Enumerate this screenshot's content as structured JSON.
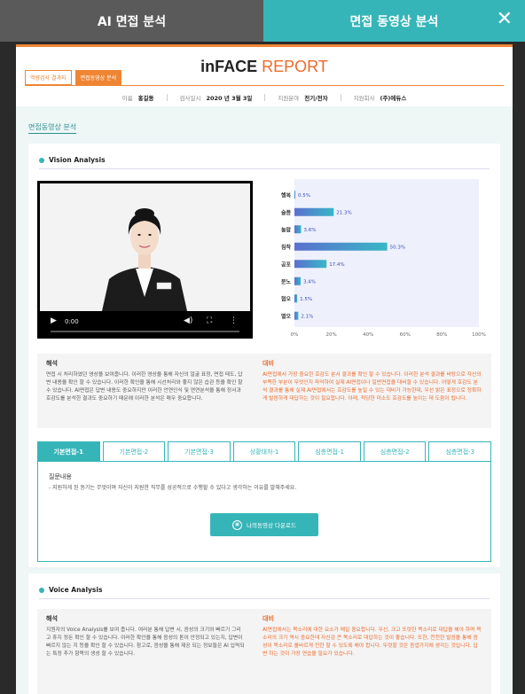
{
  "topbar": {
    "left_tab": "AI 면접 분석",
    "right_tab": "면접 동영상 분석",
    "close_icon": "close-icon"
  },
  "report": {
    "subtabs": [
      "역량검사 결과지",
      "면접동영상 분석"
    ],
    "title_bold": "inFACE",
    "title_rest": "REPORT",
    "info": [
      {
        "label": "이름",
        "value": "홍길동"
      },
      {
        "label": "검사일시",
        "value": "2020 년 3월 3일"
      },
      {
        "label": "지원분야",
        "value": "전기/전자"
      },
      {
        "label": "지원회사",
        "value": "(주)에듀스"
      }
    ]
  },
  "section_label": "면접동영상 분석",
  "vision": {
    "title": "Vision Analysis",
    "video_time": "0:00",
    "analysis_title": "해석",
    "analysis_text": "면접 시 처리하였던 영상을 보여줍니다. 이러한 영상을 통해 자신의 얼굴 표정, 면접 태도, 답변 내용을 확인 할 수 있습니다. 이러한 확인을 통해 시선처리와 좋지 않은 습관 등을 확인 할 수 있습니다. AI면접은 답변 내용도 중요하지만 이러한 언연인식 및 연연분석을 통해 정서과 호감도를 분석한 결과도 중요하기 때문에 이러한 분석은 매우 중요합니다.",
    "advice_title": "대비",
    "advice_text": "AI면접에서 가장 중요한 호감도 분서 결과를 확인 할 수 있습니다. 이러한 분석 결과를 바탕으로 자신의 부족한 부분이 무엇인지 파악하여 실제 AI면접이나 일반면접을 대비할 수 있습니다. 어떻게 호감도 분석 결과를 통해 실제 AI면접에서는 호감도를 높일 수 있는 대비가 가능한데, 우선 밝은 표정으로 정확하게 발음하게 대답하는 것이 필요합니다. 아래, 적당한 미소도 호감도를 높이는 데 도움이 됩니다."
  },
  "chart_data": {
    "type": "bar",
    "orientation": "horizontal",
    "categories": [
      "행복",
      "슬픔",
      "놀람",
      "침착",
      "공포",
      "분노",
      "혐오",
      "멸오"
    ],
    "values": [
      0.5,
      21.3,
      3.6,
      50.3,
      17.4,
      3.4,
      1.5,
      2.1
    ],
    "value_labels": [
      "0.5%",
      "21.3%",
      "3.6%",
      "50.3%",
      "17.4%",
      "3.4%",
      "1.5%",
      "2.1%"
    ],
    "xlim": [
      0,
      100
    ],
    "xticks": [
      "0%",
      "20%",
      "40%",
      "60%",
      "80%",
      "100%"
    ],
    "colors": {
      "bar_start": "#5b6fd0",
      "bar_end": "#37b7c6",
      "background": "#eef0fb",
      "label": "#3b4fb8"
    }
  },
  "questions": {
    "tabs": [
      "기본면접-1",
      "기본면접-2",
      "기본면접-3",
      "상황대처-1",
      "심층면접-1",
      "심층면접-2",
      "심층면접-3"
    ],
    "head": "질문내용",
    "text": "- 지원하게 된 동기는 무엇이며 자신이 지원한 직무를 성공적으로 수행할 수 있다고 생각하는 이유를 말해주세요.",
    "download_label": "나의동영상 다운로드"
  },
  "voice": {
    "title": "Voice Analysis",
    "analysis_title": "해석",
    "analysis_text": "지원자의 Voice Analysis를 보여 줍니다. 여러분 통해 답변 시, 음성의 크기와 빠르기 그리고 휴지 정돈 확인 할 수 있습니다. 이러한 확인을 통해 음성의 톤이 안정되고 있는지, 답변이 빠르지 않는 지 등을 확인 할 수 있습니다. 참고로, 음성을 통해 제공 되는 정보들은 AI 입력되는 특정 추가 항목의 생성 할 수 있습니다.",
    "advice_title": "대비",
    "advice_text": "AI면접에서는 목소리에 대한 요소가 매일 중요합니다. 우선, 크고 또렷한 목소리로 대답을 해야 하며 목소리의 크기 역시 중요한데 자신감 큰 목소리로 대답하는 것이 좋습니다. 또한, 천천한 발음을 통해 음성이 목소리로 올바르게 전한 할 수 있도록 해야 합니다. 뚜렷할 것은 음엽가지에 생각는 것입니다. 답변 하는 것이 가장 연습을 필요가 있습니다."
  }
}
